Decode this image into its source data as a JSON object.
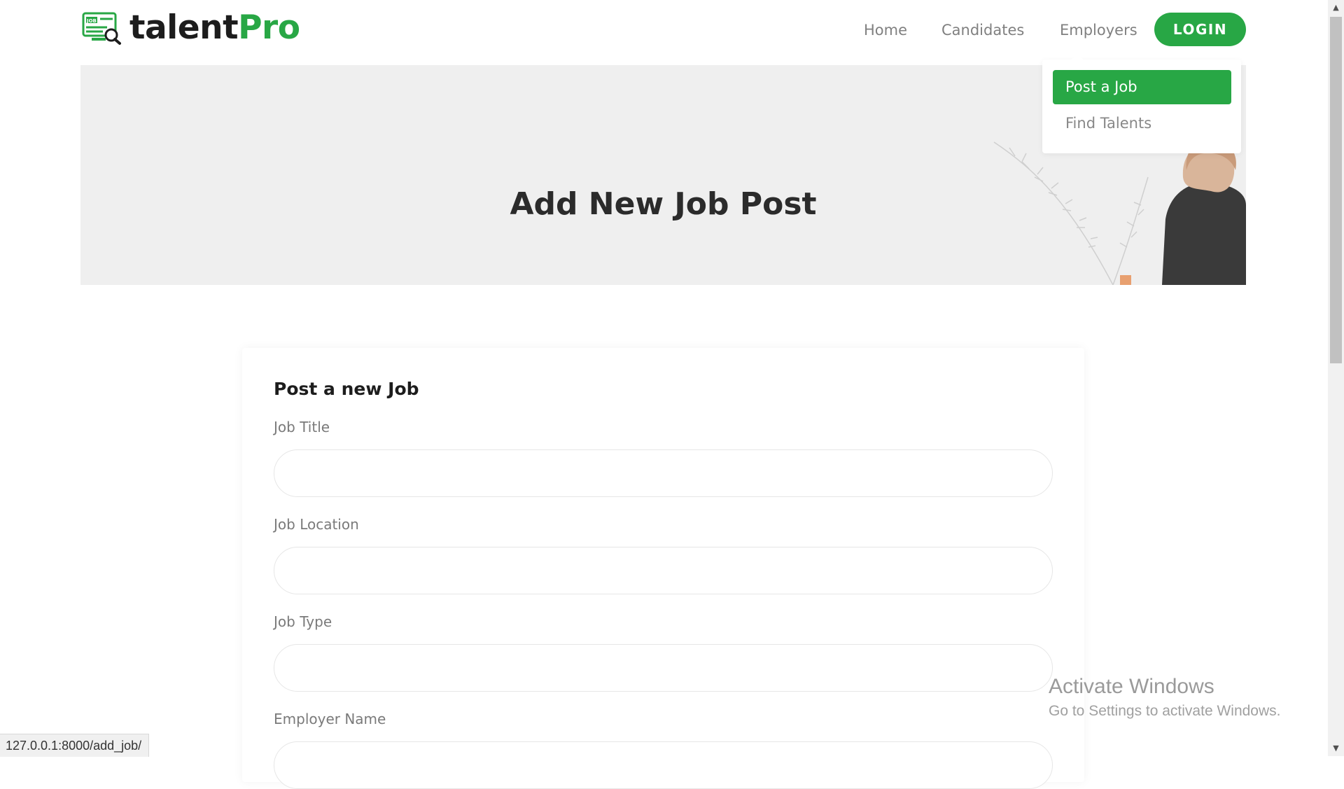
{
  "brand": {
    "name_part1": "talent",
    "name_part2": "Pro",
    "icon_text": "JOB",
    "accent_color": "#28a745"
  },
  "nav": {
    "home": "Home",
    "candidates": "Candidates",
    "employers": "Employers",
    "login": "LOGIN"
  },
  "employers_dropdown": {
    "items": [
      {
        "label": "Post a Job",
        "active": true
      },
      {
        "label": "Find Talents",
        "active": false
      }
    ]
  },
  "hero": {
    "title": "Add New Job Post"
  },
  "form": {
    "title": "Post a new Job",
    "fields": [
      {
        "label": "Job Title",
        "value": ""
      },
      {
        "label": "Job Location",
        "value": ""
      },
      {
        "label": "Job Type",
        "value": ""
      },
      {
        "label": "Employer Name",
        "value": ""
      }
    ]
  },
  "watermark": {
    "title": "Activate Windows",
    "subtitle": "Go to Settings to activate Windows."
  },
  "status_bar": {
    "url": "127.0.0.1:8000/add_job/"
  }
}
